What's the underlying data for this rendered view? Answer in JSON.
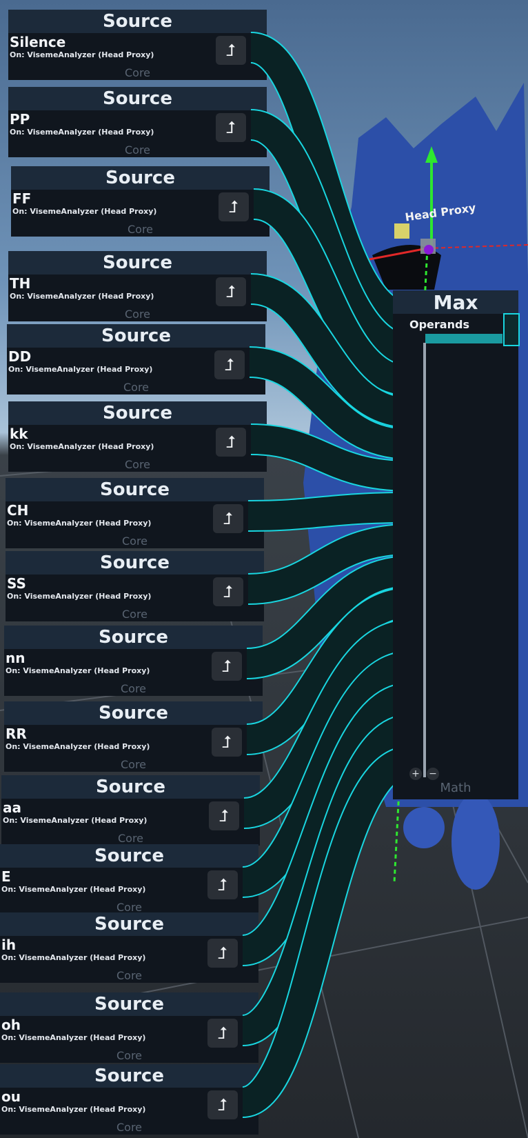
{
  "source_nodes": [
    {
      "title": "Source",
      "label": "Silence",
      "subtitle": "On: VisemeAnalyzer (Head Proxy)",
      "category": "Core",
      "output_icon": "output-arrow-icon"
    },
    {
      "title": "Source",
      "label": "PP",
      "subtitle": "On: VisemeAnalyzer (Head Proxy)",
      "category": "Core",
      "output_icon": "output-arrow-icon"
    },
    {
      "title": "Source",
      "label": "FF",
      "subtitle": "On: VisemeAnalyzer (Head Proxy)",
      "category": "Core",
      "output_icon": "output-arrow-icon"
    },
    {
      "title": "Source",
      "label": "TH",
      "subtitle": "On: VisemeAnalyzer (Head Proxy)",
      "category": "Core",
      "output_icon": "output-arrow-icon"
    },
    {
      "title": "Source",
      "label": "DD",
      "subtitle": "On: VisemeAnalyzer (Head Proxy)",
      "category": "Core",
      "output_icon": "output-arrow-icon"
    },
    {
      "title": "Source",
      "label": "kk",
      "subtitle": "On: VisemeAnalyzer (Head Proxy)",
      "category": "Core",
      "output_icon": "output-arrow-icon"
    },
    {
      "title": "Source",
      "label": "CH",
      "subtitle": "On: VisemeAnalyzer (Head Proxy)",
      "category": "Core",
      "output_icon": "output-arrow-icon"
    },
    {
      "title": "Source",
      "label": "SS",
      "subtitle": "On: VisemeAnalyzer (Head Proxy)",
      "category": "Core",
      "output_icon": "output-arrow-icon"
    },
    {
      "title": "Source",
      "label": "nn",
      "subtitle": "On: VisemeAnalyzer (Head Proxy)",
      "category": "Core",
      "output_icon": "output-arrow-icon"
    },
    {
      "title": "Source",
      "label": "RR",
      "subtitle": "On: VisemeAnalyzer (Head Proxy)",
      "category": "Core",
      "output_icon": "output-arrow-icon"
    },
    {
      "title": "Source",
      "label": "aa",
      "subtitle": "On: VisemeAnalyzer (Head Proxy)",
      "category": "Core",
      "output_icon": "output-arrow-icon"
    },
    {
      "title": "Source",
      "label": "E",
      "subtitle": "On: VisemeAnalyzer (Head Proxy)",
      "category": "Core",
      "output_icon": "output-arrow-icon"
    },
    {
      "title": "Source",
      "label": "ih",
      "subtitle": "On: VisemeAnalyzer (Head Proxy)",
      "category": "Core",
      "output_icon": "output-arrow-icon"
    },
    {
      "title": "Source",
      "label": "oh",
      "subtitle": "On: VisemeAnalyzer (Head Proxy)",
      "category": "Core",
      "output_icon": "output-arrow-icon"
    },
    {
      "title": "Source",
      "label": "ou",
      "subtitle": "On: VisemeAnalyzer (Head Proxy)",
      "category": "Core",
      "output_icon": "output-arrow-icon"
    }
  ],
  "max_node": {
    "title": "Max",
    "operands_label": "Operands",
    "add_label": "+",
    "remove_label": "−",
    "category": "Math"
  },
  "world": {
    "head_proxy_label": "Head Proxy",
    "wire_color": "#19d6e0",
    "node_header_color": "#1c2a3a",
    "node_body_color": "#10161e",
    "avatar_color": "#2c4fa8"
  }
}
